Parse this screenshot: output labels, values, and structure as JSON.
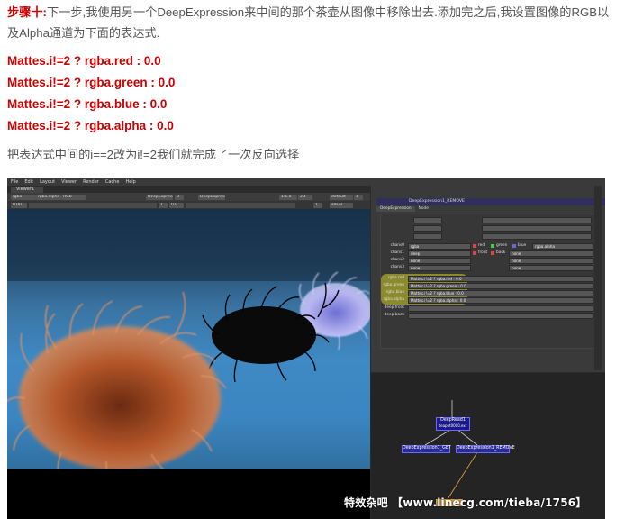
{
  "article": {
    "step_label": "步骤十:",
    "intro": "下一步,我使用另一个DeepExpression来中间的那个茶壶从图像中移除出去.添加完之后,我设置图像的RGB以及Alpha通道为下面的表达式.",
    "expressions": [
      "Mattes.i!=2 ? rgba.red : 0.0",
      "Mattes.i!=2 ? rgba.green : 0.0",
      "Mattes.i!=2 ? rgba.blue : 0.0",
      "Mattes.i!=2 ? rgba.alpha : 0.0"
    ],
    "note": "把表达式中间的i==2改为i!=2我们就完成了一次反向选择"
  },
  "nuke": {
    "menu": [
      "File",
      "Edit",
      "Layout",
      "Viewer",
      "Render",
      "Cache",
      "Help"
    ],
    "viewer_tab": "Viewer1",
    "viewer_toolbar": [
      "rgba",
      "rgba.alpha",
      "RGB",
      "DeepExpressi",
      "B",
      "DeepExpressi",
      "1:1.8",
      "2D",
      "default",
      "1",
      "0.00",
      "1",
      "0.0",
      "1",
      "sRGB"
    ],
    "properties": {
      "node_name": "DeepExpression1_REMOVE",
      "tabs": [
        "DeepExpression",
        "Node"
      ],
      "channel_rows": [
        {
          "label": "chans0",
          "value": "rgba",
          "c1": "red",
          "c2": "green",
          "c3": "blue",
          "c4": "rgba.alpha"
        },
        {
          "label": "chans1",
          "value": "deep",
          "c1": "front",
          "c2": "back",
          "c4": "none"
        },
        {
          "label": "chans2",
          "value": "none",
          "c4": "none"
        },
        {
          "label": "chans3",
          "value": "none",
          "c4": "none"
        }
      ],
      "expr_rows": [
        {
          "label": "rgba.red",
          "value": "Mattes.i!=2 ? rgba.red : 0.0"
        },
        {
          "label": "rgba.green",
          "value": "Mattes.i!=2 ? rgba.green : 0.0"
        },
        {
          "label": "rgba.blue",
          "value": "Mattes.i!=2 ? rgba.blue : 0.0"
        },
        {
          "label": "rgba.alpha",
          "value": "Mattes.i!=2 ? rgba.alpha : 0.0"
        }
      ],
      "deep_rows": [
        "deep.front",
        "deep.back"
      ]
    },
    "dag_nodes": {
      "read_title": "DeepRead1",
      "read_file": "teapot0000.exr",
      "left_node": "DeepExpression1_GET",
      "right_node": "DeepExpression1_REMOVE"
    },
    "colors": {
      "highlight": "#d2d228",
      "node_blue": "#1a1a8a",
      "orange_link": "#e6a84a"
    }
  },
  "watermark": "特效杂吧 【www.linecg.com/tieba/1756】"
}
